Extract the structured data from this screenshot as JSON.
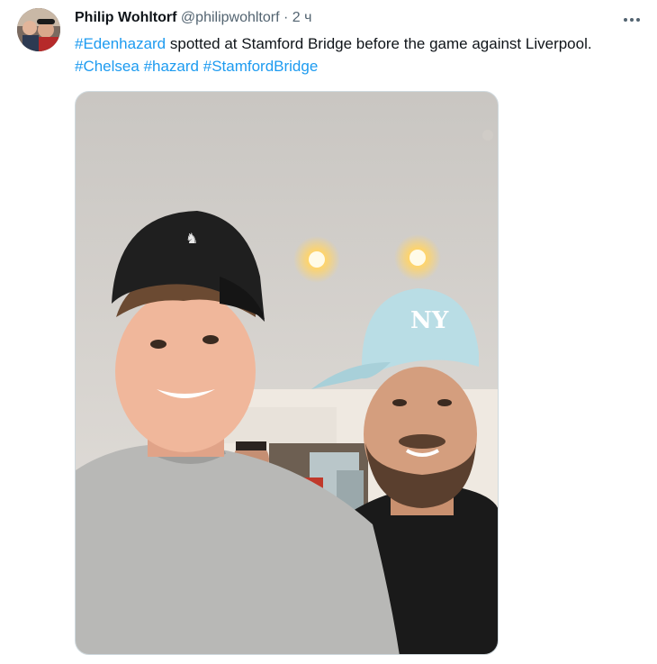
{
  "tweet": {
    "author": {
      "display_name": "Philip Wohltorf",
      "handle": "@philipwohltorf",
      "avatar_icon": "user-avatar"
    },
    "separator": "·",
    "time": "2 ч",
    "more_icon": "more-horizontal-icon",
    "text_parts": {
      "tag1": "#Edenhazard",
      "text1": " spotted at Stamford Bridge before the game against Liverpool. ",
      "tag2": "#Chelsea",
      "space1": " ",
      "tag3": "#hazard",
      "space2": " ",
      "tag4": "#StamfordBridge"
    },
    "media": {
      "type": "photo",
      "subject": "selfie-two-men-caps"
    },
    "colors": {
      "link": "#1d9bf0",
      "secondary_text": "#536471",
      "primary_text": "#0f1419"
    }
  }
}
